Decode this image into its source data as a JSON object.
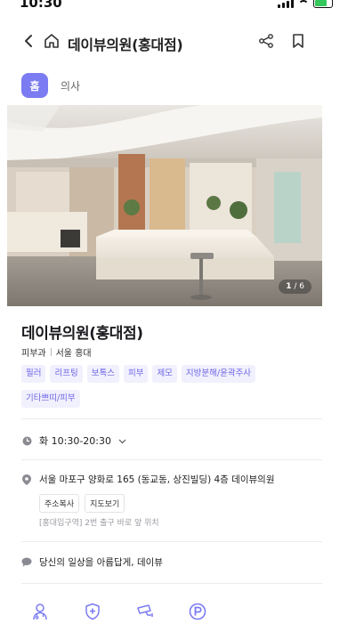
{
  "status": {
    "time": "10:30"
  },
  "header": {
    "title": "데이뷰의원(홍대점)"
  },
  "tabs": {
    "badge": "홈",
    "label": "의사"
  },
  "gallery": {
    "current": "1",
    "total": "/ 6"
  },
  "clinic": {
    "name": "데이뷰의원(홍대점)",
    "department": "피부과",
    "area": "서울 홍대",
    "tags": [
      "필러",
      "리프팅",
      "보톡스",
      "피부",
      "제모",
      "지방분해/윤곽주사",
      "기타쁘띠/피부"
    ]
  },
  "hours": {
    "text": "화 10:30-20:30"
  },
  "address": {
    "text": "서울 마포구 양화로 165 (동교동, 상진빌딩) 4층 데이뷰의원",
    "copy_label": "주소복사",
    "map_label": "지도보기",
    "subway": "[홍대입구역] 2번 출구 바로 앞 위치"
  },
  "slogan": {
    "text": "당신의 일상을 아름답게, 데이뷰"
  },
  "icons": {
    "back": "back-chevron-icon",
    "home": "home-icon",
    "share": "share-icon",
    "bookmark": "bookmark-icon",
    "clock": "clock-icon",
    "pin": "location-pin-icon",
    "chat": "speech-bubble-icon",
    "doctor": "doctor-icon",
    "shield": "shield-plus-icon",
    "cctv": "cctv-icon",
    "parking": "parking-icon"
  },
  "colors": {
    "accent": "#7b7bf2",
    "chip_bg": "#f1f0fd",
    "chip_text": "#6e66e6"
  }
}
